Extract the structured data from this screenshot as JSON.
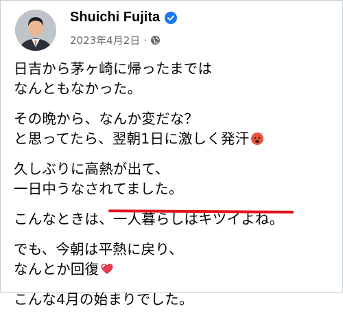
{
  "post": {
    "author": "Shuichi Fujita",
    "date": "2023年4月2日",
    "separator": "·",
    "verified_icon": "verified-badge-icon",
    "audience_icon": "globe-icon",
    "paragraphs": [
      [
        "日吉から茅ヶ崎に帰ったまでは",
        "なんともなかった。"
      ],
      [
        "その晩から、なんか変だな？",
        "と思ってたら、翌朝1日に激しく発汗"
      ],
      [
        "久しぶりに高熱が出て、",
        "一日中うなされてました。"
      ],
      [
        "こんなときは、一人暮らしはキツイよね。"
      ],
      [
        "でも、今朝は平熱に戻り、",
        "なんとか回復"
      ],
      [
        "こんな4月の始まりでした。"
      ]
    ]
  },
  "annotation": {
    "type": "red-underline",
    "color": "#e4111a"
  }
}
